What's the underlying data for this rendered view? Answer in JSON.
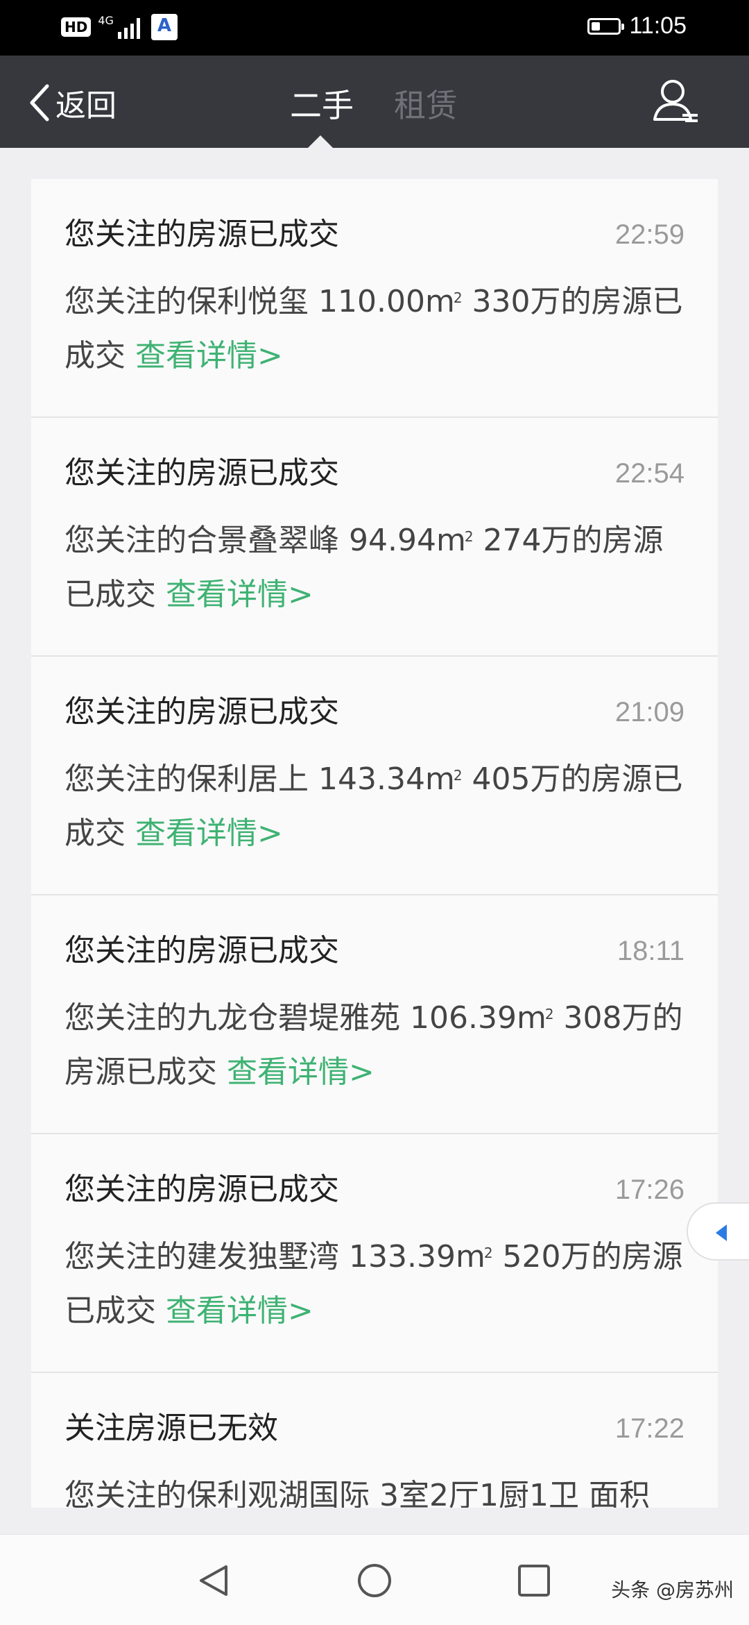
{
  "status_bar": {
    "hd_label": "HD",
    "network_label": "4G",
    "time": "11:05",
    "battery_level": 0.3
  },
  "nav": {
    "back_label": "返回",
    "tabs": [
      {
        "label": "二手",
        "active": true
      },
      {
        "label": "租赁",
        "active": false
      }
    ]
  },
  "messages": [
    {
      "title": "您关注的房源已成交",
      "time": "22:59",
      "text_before": "您关注的保利悦玺 110.00m",
      "sup": "2",
      "text_after": " 330万的房源已成交",
      "link": "查看详情>"
    },
    {
      "title": "您关注的房源已成交",
      "time": "22:54",
      "text_before": "您关注的合景叠翠峰 94.94m",
      "sup": "2",
      "text_after": " 274万的房源已成交",
      "link": "查看详情>"
    },
    {
      "title": "您关注的房源已成交",
      "time": "21:09",
      "text_before": "您关注的保利居上 143.34m",
      "sup": "2",
      "text_after": " 405万的房源已成交",
      "link": "查看详情>"
    },
    {
      "title": "您关注的房源已成交",
      "time": "18:11",
      "text_before": "您关注的九龙仓碧堤雅苑 106.39m",
      "sup": "2",
      "text_after": " 308万的房源已成交",
      "link": "查看详情>"
    },
    {
      "title": "您关注的房源已成交",
      "time": "17:26",
      "text_before": "您关注的建发独墅湾 133.39m",
      "sup": "2",
      "text_after": " 520万的房源已成交",
      "link": "查看详情>"
    },
    {
      "title": "关注房源已无效",
      "time": "17:22",
      "text_before": "您关注的保利观湖国际 3室2厅1厨1卫 面积",
      "sup": "",
      "text_after": "",
      "link": ""
    }
  ],
  "watermark": "头条 @房苏州",
  "icons": {
    "back": "chevron-left-icon",
    "user": "user-icon",
    "side": "side-arrow-icon",
    "nav_back": "triangle-back-icon",
    "nav_home": "circle-home-icon",
    "nav_recent": "square-recent-icon"
  },
  "colors": {
    "nav_bg": "#36383e",
    "link": "#3fb273",
    "page_bg": "#efeff1"
  }
}
